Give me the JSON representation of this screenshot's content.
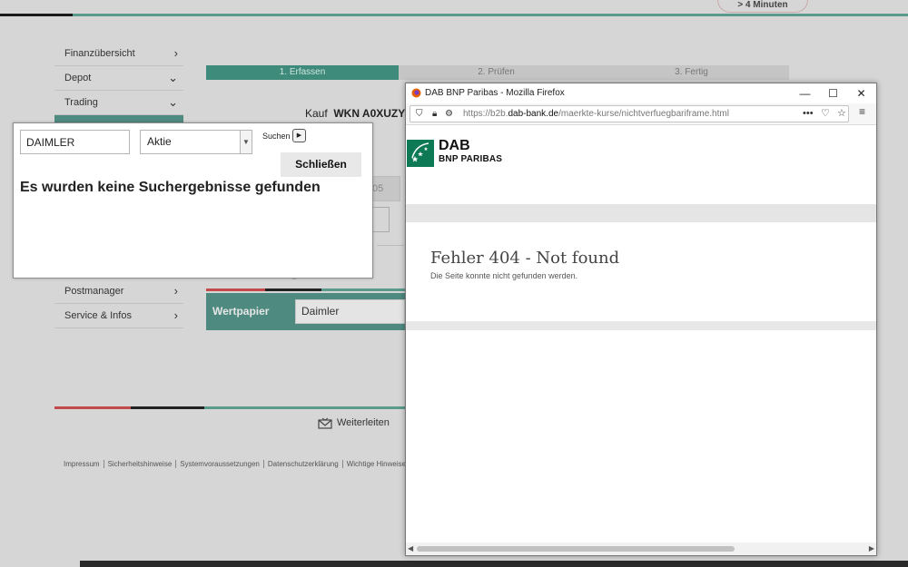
{
  "header": {
    "timer": "> 4 Minuten"
  },
  "nav": {
    "items": [
      {
        "label": "Finanzübersicht"
      },
      {
        "label": "Depot"
      },
      {
        "label": "Trading"
      },
      {
        "label": "Postmanager"
      },
      {
        "label": "Service & Infos"
      }
    ]
  },
  "steps": [
    {
      "label": "1. Erfassen"
    },
    {
      "label": "2. Prüfen"
    },
    {
      "label": "3. Fertig"
    }
  ],
  "order": {
    "kauf_label": "Kauf",
    "wkn": "WKN A0XUZY",
    "ghost_value": "05",
    "wertpapier_label": "Wertpapier",
    "wertpapier_value": "Daimler"
  },
  "footer": {
    "forward": "Weiterleiten",
    "links": [
      "Impressum",
      "Sicherheitshinweise",
      "Systemvoraussetzungen",
      "Datenschutzerklärung",
      "Wichtige Hinweise und"
    ]
  },
  "popup": {
    "search_value": "DAIMLER",
    "type_selected": "Aktie",
    "search_label": "Suchen",
    "close_label": "Schließen",
    "message": "Es wurden keine Suchergebnisse gefunden"
  },
  "firefox": {
    "title": "DAB BNP Paribas - Mozilla Firefox",
    "url_prefix": "https://b2b.",
    "url_domain": "dab-bank.de",
    "url_path": "/maerkte-kurse/nichtverfuegbariframe.html",
    "brand_name": "DAB",
    "brand_sub": "BNP PARIBAS",
    "error_title": "Fehler 404 - Not found",
    "error_text": "Die Seite konnte nicht gefunden werden."
  },
  "colors": {
    "bank_green": "#3e8b7c",
    "dab_green": "#0e7a55",
    "accent_red": "#c34a4a"
  }
}
